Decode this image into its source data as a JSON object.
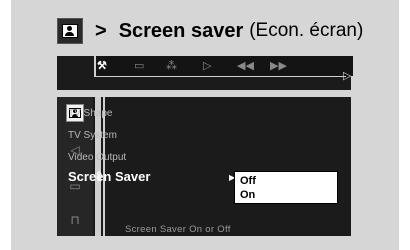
{
  "heading": {
    "arrow": ">",
    "title": "Screen saver",
    "subtitle": "(Econ. écran)"
  },
  "toolbar": {
    "icons": [
      "settings-icon",
      "subtitle-icon",
      "audio-icon",
      "play-icon",
      "rewind-icon",
      "fast-forward-icon"
    ],
    "active_index": 0
  },
  "sidebar": {
    "icons": [
      "general-setup-icon",
      "audio-setup-icon",
      "subtitle-setup-icon",
      "lock-icon"
    ],
    "active_index": 0
  },
  "menu": {
    "items": [
      "TV Shape",
      "TV System",
      "Video Output",
      "Screen Saver"
    ],
    "selected_index": 3
  },
  "submenu": {
    "options": [
      "Off",
      "On"
    ],
    "selected_index": 0
  },
  "status": "Screen Saver On or Off"
}
